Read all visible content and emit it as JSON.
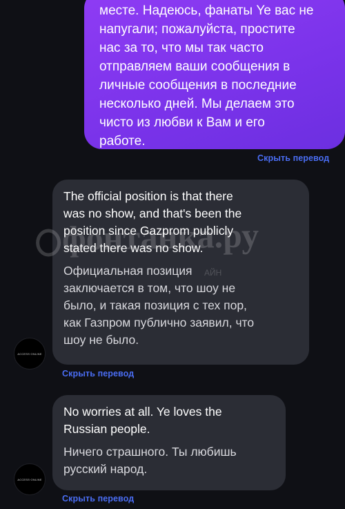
{
  "messages": {
    "outgoing": {
      "text": "месте. Надеюсь, фанаты Ye вас не\nнапугали; пожалуйста, простите\nнас за то, что мы так часто\nотправляем ваши сообщения в\nличные сообщения в последние\nнесколько дней. Мы делаем это\nчисто из любви к Вам и его\nработе.",
      "hide_translation": "Скрыть перевод"
    },
    "incoming": [
      {
        "text": "The official position is that there\nwas no show, and that's been the\nposition since Gazprom publicly\nstated there was no show.",
        "translation": "Официальная позиция\nзаключается в том, что шоу не\nбыло, и такая позиция с тех пор,\nкак Газпром публично заявил, что\nшоу не было.",
        "hide_translation": "Скрыть перевод"
      },
      {
        "text": "No worries at all. Ye loves the\nRussian people.",
        "translation": "Ничего страшного. Ты любишь\nрусский народ.",
        "hide_translation": "Скрыть перевод"
      }
    ]
  },
  "avatar": {
    "label": "ACCESS·ONLINE",
    "icon": "account-avatar-icon"
  },
  "watermark": {
    "main": "фонтанка.ру",
    "small": "АЙН"
  },
  "colors": {
    "background": "#0f1015",
    "outgoing_bubble": "#8f3cf4",
    "incoming_bubble": "#2b2d35",
    "link": "#4a6df3"
  }
}
